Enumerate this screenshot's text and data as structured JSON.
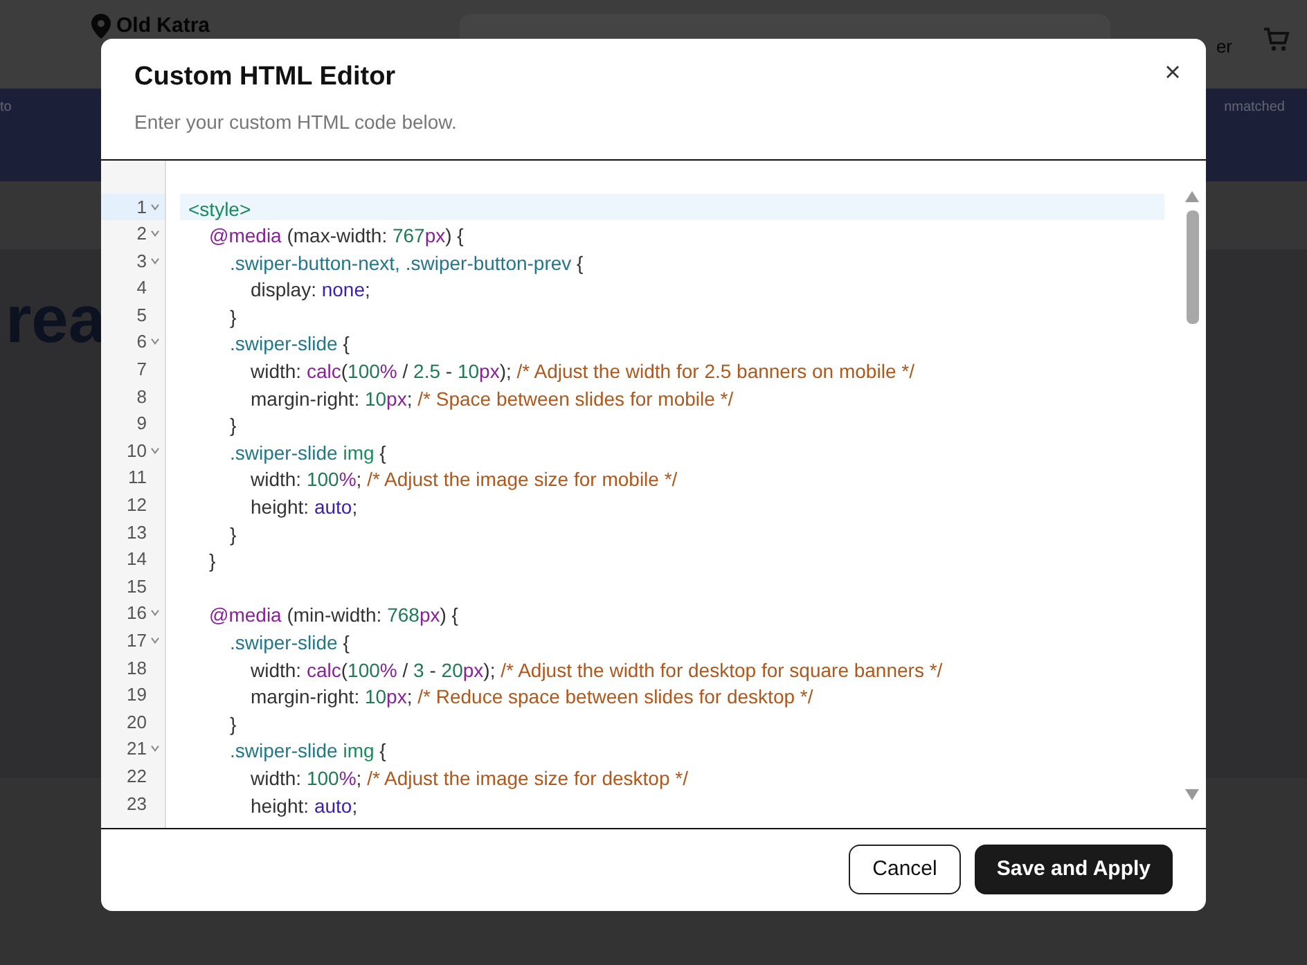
{
  "background_page": {
    "location": "Old Katra",
    "header_link": "er",
    "banner_texts": [
      "to",
      "nmatched"
    ],
    "hero_title": "rea"
  },
  "dialog": {
    "title": "Custom HTML Editor",
    "subtitle": "Enter your custom HTML code below.",
    "code_lines": [
      {
        "number": "1",
        "foldable": true,
        "selected": true,
        "tokens": [
          {
            "kind": "tag",
            "text": "<style>"
          }
        ],
        "children": [
          {
            "number": "2",
            "foldable": true,
            "selected": false,
            "tokens": [
              {
                "kind": "atrule",
                "text": "@media"
              },
              {
                "kind": "plain",
                "text": " (max-width: "
              },
              {
                "kind": "number",
                "text": "767"
              },
              {
                "kind": "unit",
                "text": "px"
              },
              {
                "kind": "plain",
                "text": ") {"
              }
            ],
            "children": [
              {
                "number": "3",
                "foldable": true,
                "selected": false,
                "tokens": [
                  {
                    "kind": "selector",
                    "text": ".swiper-button-next,"
                  },
                  {
                    "kind": "selector",
                    "text": " .swiper-button-prev"
                  },
                  {
                    "kind": "plain",
                    "text": " {"
                  }
                ],
                "children": [
                  {
                    "number": "4",
                    "foldable": false,
                    "selected": false,
                    "tokens": [
                      {
                        "kind": "plain",
                        "text": "display: "
                      },
                      {
                        "kind": "keyword",
                        "text": "none"
                      },
                      {
                        "kind": "plain",
                        "text": ";"
                      }
                    ]
                  }
                ]
              },
              {
                "number": "5",
                "foldable": false,
                "selected": false,
                "tokens": [
                  {
                    "kind": "plain",
                    "text": "}"
                  }
                ]
              },
              {
                "number": "6",
                "foldable": true,
                "selected": false,
                "tokens": [
                  {
                    "kind": "selector",
                    "text": ".swiper-slide"
                  },
                  {
                    "kind": "plain",
                    "text": " {"
                  }
                ],
                "children": [
                  {
                    "number": "7",
                    "foldable": false,
                    "selected": false,
                    "tokens": [
                      {
                        "kind": "plain",
                        "text": "width: "
                      },
                      {
                        "kind": "func",
                        "text": "calc"
                      },
                      {
                        "kind": "plain",
                        "text": "("
                      },
                      {
                        "kind": "number",
                        "text": "100"
                      },
                      {
                        "kind": "unit",
                        "text": "%"
                      },
                      {
                        "kind": "plain",
                        "text": " / "
                      },
                      {
                        "kind": "number",
                        "text": "2.5"
                      },
                      {
                        "kind": "plain",
                        "text": " - "
                      },
                      {
                        "kind": "number",
                        "text": "10"
                      },
                      {
                        "kind": "unit",
                        "text": "px"
                      },
                      {
                        "kind": "plain",
                        "text": "); "
                      },
                      {
                        "kind": "comment",
                        "text": "/* Adjust the width for 2.5 banners on mobile */"
                      }
                    ]
                  },
                  {
                    "number": "8",
                    "foldable": false,
                    "selected": false,
                    "tokens": [
                      {
                        "kind": "plain",
                        "text": "margin-right: "
                      },
                      {
                        "kind": "number",
                        "text": "10"
                      },
                      {
                        "kind": "unit",
                        "text": "px"
                      },
                      {
                        "kind": "plain",
                        "text": "; "
                      },
                      {
                        "kind": "comment",
                        "text": "/* Space between slides for mobile */"
                      }
                    ]
                  }
                ]
              },
              {
                "number": "9",
                "foldable": false,
                "selected": false,
                "tokens": [
                  {
                    "kind": "plain",
                    "text": "}"
                  }
                ]
              },
              {
                "number": "10",
                "foldable": true,
                "selected": false,
                "tokens": [
                  {
                    "kind": "selector",
                    "text": ".swiper-slide"
                  },
                  {
                    "kind": "tag",
                    "text": " img"
                  },
                  {
                    "kind": "plain",
                    "text": " {"
                  }
                ],
                "children": [
                  {
                    "number": "11",
                    "foldable": false,
                    "selected": false,
                    "tokens": [
                      {
                        "kind": "plain",
                        "text": "width: "
                      },
                      {
                        "kind": "number",
                        "text": "100"
                      },
                      {
                        "kind": "unit",
                        "text": "%"
                      },
                      {
                        "kind": "plain",
                        "text": "; "
                      },
                      {
                        "kind": "comment",
                        "text": "/* Adjust the image size for mobile */"
                      }
                    ]
                  },
                  {
                    "number": "12",
                    "foldable": false,
                    "selected": false,
                    "tokens": [
                      {
                        "kind": "plain",
                        "text": "height: "
                      },
                      {
                        "kind": "keyword",
                        "text": "auto"
                      },
                      {
                        "kind": "plain",
                        "text": ";"
                      }
                    ]
                  }
                ]
              },
              {
                "number": "13",
                "foldable": false,
                "selected": false,
                "tokens": [
                  {
                    "kind": "plain",
                    "text": "}"
                  }
                ]
              }
            ]
          },
          {
            "number": "14",
            "foldable": false,
            "selected": false,
            "tokens": [
              {
                "kind": "plain",
                "text": "}"
              }
            ]
          },
          {
            "number": "15",
            "foldable": false,
            "selected": false
          },
          {
            "number": "16",
            "foldable": true,
            "selected": false,
            "tokens": [
              {
                "kind": "atrule",
                "text": "@media"
              },
              {
                "kind": "plain",
                "text": " (min-width: "
              },
              {
                "kind": "number",
                "text": "768"
              },
              {
                "kind": "unit",
                "text": "px"
              },
              {
                "kind": "plain",
                "text": ") {"
              }
            ],
            "children": [
              {
                "number": "17",
                "foldable": true,
                "selected": false,
                "tokens": [
                  {
                    "kind": "selector",
                    "text": ".swiper-slide"
                  },
                  {
                    "kind": "plain",
                    "text": " {"
                  }
                ],
                "children": [
                  {
                    "number": "18",
                    "foldable": false,
                    "selected": false,
                    "tokens": [
                      {
                        "kind": "plain",
                        "text": "width: "
                      },
                      {
                        "kind": "func",
                        "text": "calc"
                      },
                      {
                        "kind": "plain",
                        "text": "("
                      },
                      {
                        "kind": "number",
                        "text": "100"
                      },
                      {
                        "kind": "unit",
                        "text": "%"
                      },
                      {
                        "kind": "plain",
                        "text": " / "
                      },
                      {
                        "kind": "number",
                        "text": "3"
                      },
                      {
                        "kind": "plain",
                        "text": " - "
                      },
                      {
                        "kind": "number",
                        "text": "20"
                      },
                      {
                        "kind": "unit",
                        "text": "px"
                      },
                      {
                        "kind": "plain",
                        "text": "); "
                      },
                      {
                        "kind": "comment",
                        "text": "/* Adjust the width for desktop for square banners */"
                      }
                    ]
                  },
                  {
                    "number": "19",
                    "foldable": false,
                    "selected": false,
                    "tokens": [
                      {
                        "kind": "plain",
                        "text": "margin-right: "
                      },
                      {
                        "kind": "number",
                        "text": "10"
                      },
                      {
                        "kind": "unit",
                        "text": "px"
                      },
                      {
                        "kind": "plain",
                        "text": "; "
                      },
                      {
                        "kind": "comment",
                        "text": "/* Reduce space between slides for desktop */"
                      }
                    ]
                  }
                ]
              },
              {
                "number": "20",
                "foldable": false,
                "selected": false,
                "tokens": [
                  {
                    "kind": "plain",
                    "text": "}"
                  }
                ]
              },
              {
                "number": "21",
                "foldable": true,
                "selected": false,
                "tokens": [
                  {
                    "kind": "selector",
                    "text": ".swiper-slide"
                  },
                  {
                    "kind": "tag",
                    "text": " img"
                  },
                  {
                    "kind": "plain",
                    "text": " {"
                  }
                ],
                "children": [
                  {
                    "number": "22",
                    "foldable": false,
                    "selected": false,
                    "tokens": [
                      {
                        "kind": "plain",
                        "text": "width: "
                      },
                      {
                        "kind": "number",
                        "text": "100"
                      },
                      {
                        "kind": "unit",
                        "text": "%"
                      },
                      {
                        "kind": "plain",
                        "text": "; "
                      },
                      {
                        "kind": "comment",
                        "text": "/* Adjust the image size for desktop */"
                      }
                    ]
                  },
                  {
                    "number": "23",
                    "foldable": false,
                    "selected": false,
                    "tokens": [
                      {
                        "kind": "plain",
                        "text": "height: "
                      },
                      {
                        "kind": "keyword",
                        "text": "auto"
                      },
                      {
                        "kind": "plain",
                        "text": ";"
                      }
                    ]
                  }
                ]
              }
            ]
          }
        ]
      }
    ],
    "buttons": [
      {
        "kind": "secondary",
        "label": "Cancel"
      },
      {
        "kind": "primary",
        "label": "Save and Apply"
      }
    ]
  }
}
